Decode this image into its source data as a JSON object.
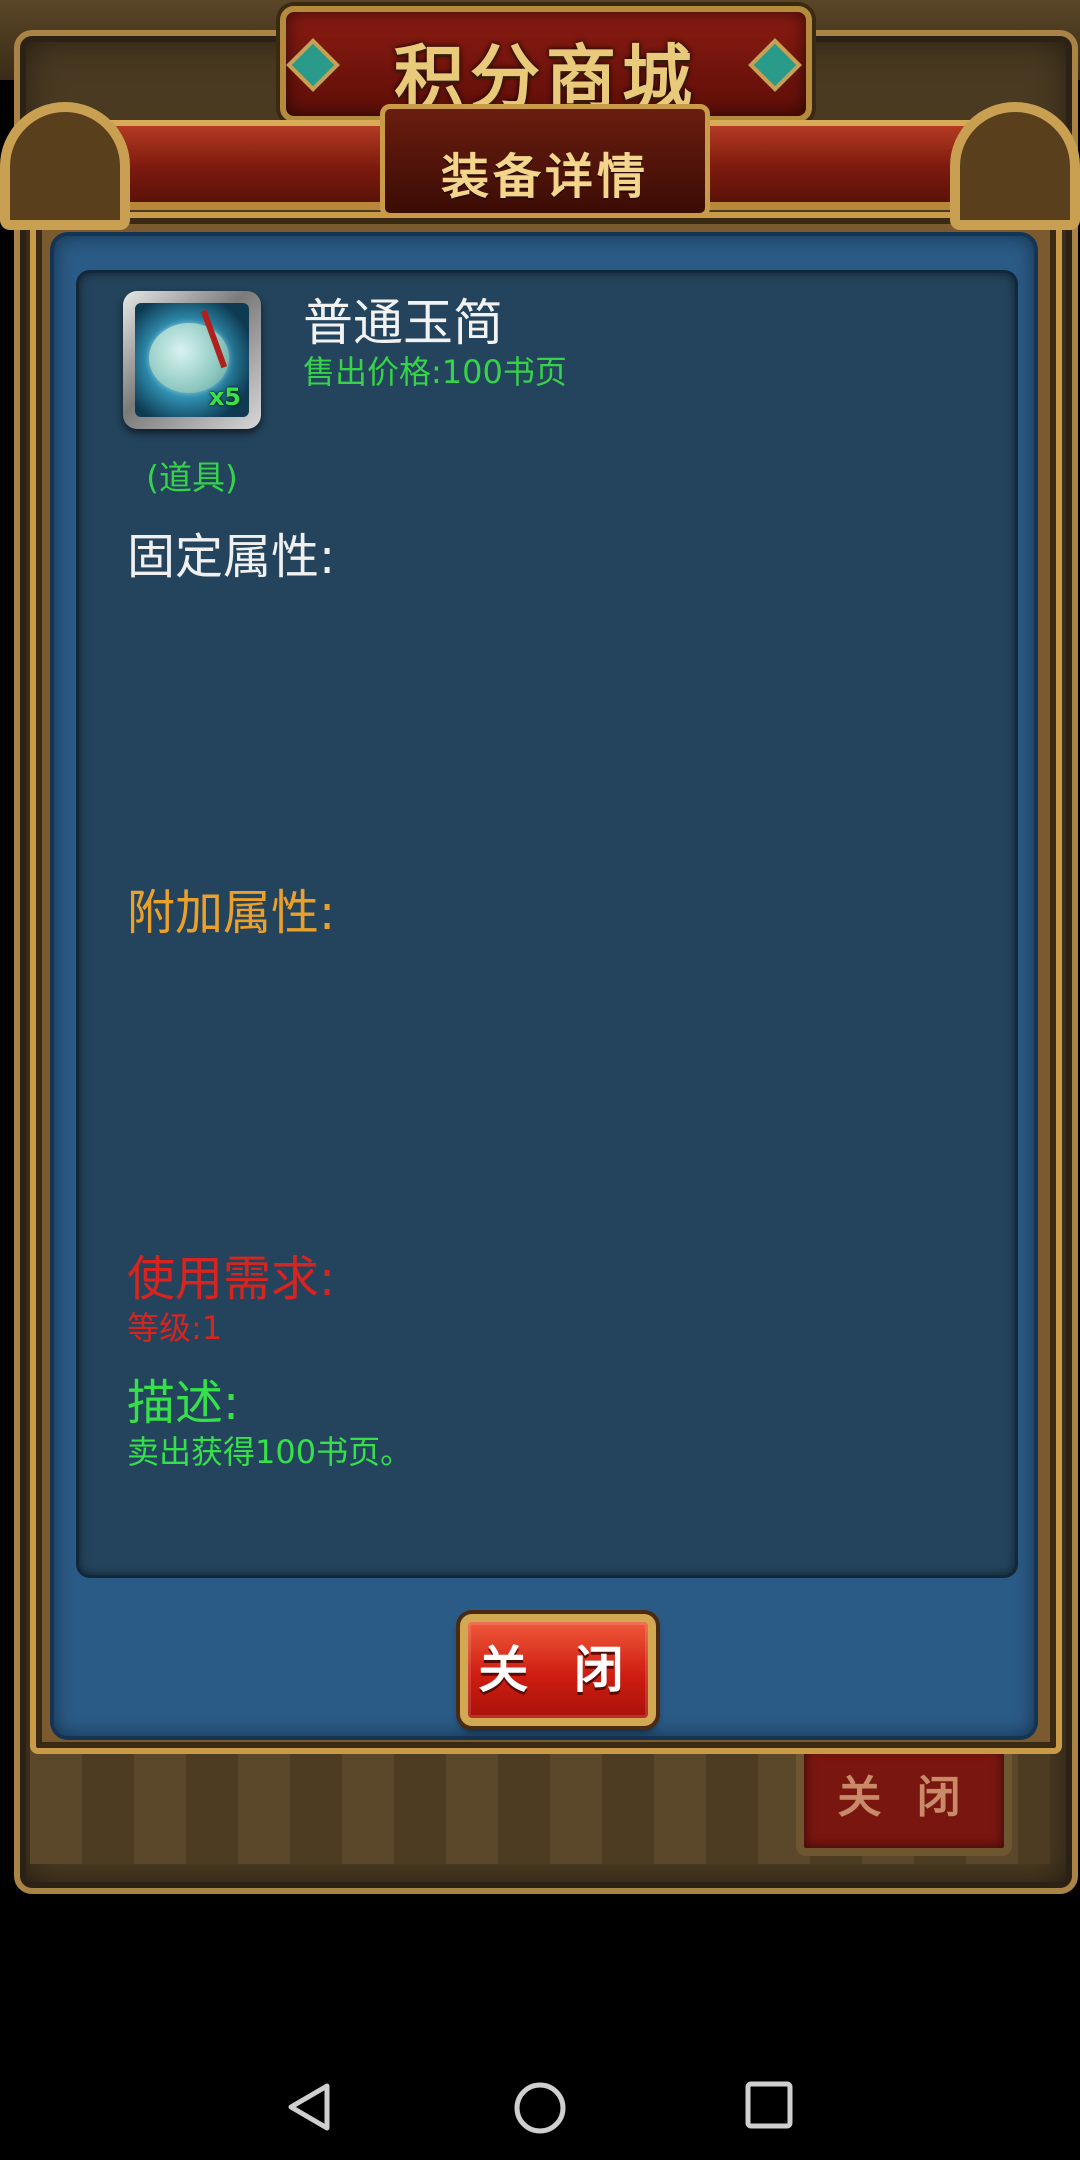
{
  "shop": {
    "title": "积分商城",
    "background_close_label": "关 闭"
  },
  "popup": {
    "header_title": "装备详情",
    "item": {
      "name": "普通玉简",
      "price": "售出价格:100书页",
      "type": "(道具)",
      "count": "x5",
      "icon": "jade-token-icon"
    },
    "sections": {
      "fixed_attributes": "固定属性:",
      "extra_attributes": "附加属性:",
      "requirements": "使用需求:",
      "requirement_value": "等级:1",
      "description": "描述:",
      "description_value": "卖出获得100书页。"
    },
    "close_label": "关 闭"
  },
  "nav": {
    "back_icon": "back-icon",
    "home_icon": "home-icon",
    "recent_icon": "recent-apps-icon"
  },
  "colors": {
    "panel_blue": "#23445c",
    "green_text": "#35d24a",
    "orange_text": "#eaa02a",
    "red_text": "#d8241e",
    "gold_trim": "#c99a48"
  }
}
